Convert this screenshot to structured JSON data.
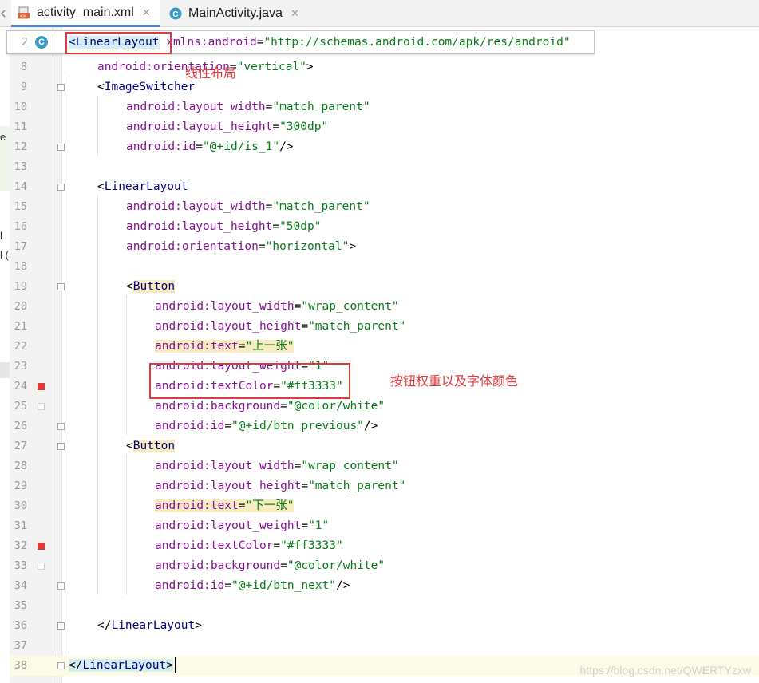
{
  "tabs": [
    {
      "label": "activity_main.xml",
      "icon": "xml-file-icon",
      "active": true
    },
    {
      "label": "MainActivity.java",
      "icon": "java-class-icon",
      "active": false
    }
  ],
  "sticky": {
    "line": "2",
    "badge": "C",
    "tag": "<LinearLayout",
    "rest_attr": " xmlns:android",
    "rest_eq": "=",
    "rest_str": "\"http://schemas.android.com/apk/res/android\""
  },
  "left_cut": {
    "e": "e",
    "l": "l",
    "paren": "l ("
  },
  "annotations": {
    "layout_note": "线性布局",
    "button_note": "按钮权重以及字体颜色"
  },
  "lines": [
    {
      "n": "8",
      "indent": "    ",
      "parts": [
        [
          "attr",
          "android:ori"
        ],
        [
          "attr",
          "entation"
        ],
        [
          "pun",
          "="
        ],
        [
          "str",
          "\"vertical\""
        ],
        [
          "pun",
          ">"
        ]
      ]
    },
    {
      "n": "9",
      "indent": "    ",
      "parts": [
        [
          "pun",
          "<"
        ],
        [
          "tag",
          "ImageSwitcher"
        ]
      ]
    },
    {
      "n": "10",
      "indent": "        ",
      "parts": [
        [
          "attr",
          "android:layout_width"
        ],
        [
          "pun",
          "="
        ],
        [
          "str",
          "\"match_parent\""
        ]
      ]
    },
    {
      "n": "11",
      "indent": "        ",
      "parts": [
        [
          "attr",
          "android:layout_height"
        ],
        [
          "pun",
          "="
        ],
        [
          "str",
          "\"300dp\""
        ]
      ]
    },
    {
      "n": "12",
      "indent": "        ",
      "parts": [
        [
          "attr",
          "android:id"
        ],
        [
          "pun",
          "="
        ],
        [
          "str",
          "\"@+id/is_1\""
        ],
        [
          "pun",
          "/>"
        ]
      ]
    },
    {
      "n": "13",
      "indent": "",
      "parts": []
    },
    {
      "n": "14",
      "indent": "    ",
      "parts": [
        [
          "pun",
          "<"
        ],
        [
          "tag",
          "LinearLayout"
        ]
      ]
    },
    {
      "n": "15",
      "indent": "        ",
      "parts": [
        [
          "attr",
          "android:layout_width"
        ],
        [
          "pun",
          "="
        ],
        [
          "str",
          "\"match_parent\""
        ]
      ]
    },
    {
      "n": "16",
      "indent": "        ",
      "parts": [
        [
          "attr",
          "android:layout_height"
        ],
        [
          "pun",
          "="
        ],
        [
          "str",
          "\"50dp\""
        ]
      ]
    },
    {
      "n": "17",
      "indent": "        ",
      "parts": [
        [
          "attr",
          "android:orientation"
        ],
        [
          "pun",
          "="
        ],
        [
          "str",
          "\"horizontal\""
        ],
        [
          "pun",
          ">"
        ]
      ]
    },
    {
      "n": "18",
      "indent": "",
      "parts": []
    },
    {
      "n": "19",
      "indent": "        ",
      "parts": [
        [
          "pun",
          "<"
        ],
        [
          "tag-hl",
          "Button"
        ]
      ]
    },
    {
      "n": "20",
      "indent": "            ",
      "parts": [
        [
          "attr",
          "android:layout_width"
        ],
        [
          "pun",
          "="
        ],
        [
          "str",
          "\"wrap_content\""
        ]
      ]
    },
    {
      "n": "21",
      "indent": "            ",
      "parts": [
        [
          "attr",
          "android:layout_height"
        ],
        [
          "pun",
          "="
        ],
        [
          "str",
          "\"match_parent\""
        ]
      ]
    },
    {
      "n": "22",
      "indent": "            ",
      "parts": [
        [
          "attr-hl",
          "android:text"
        ],
        [
          "pun-hl",
          "="
        ],
        [
          "str-hl",
          "\"上一张\""
        ]
      ]
    },
    {
      "n": "23",
      "indent": "            ",
      "parts": [
        [
          "attr",
          "android:layout_weight"
        ],
        [
          "pun",
          "="
        ],
        [
          "str",
          "\"1\""
        ]
      ]
    },
    {
      "n": "24",
      "indent": "            ",
      "parts": [
        [
          "attr",
          "android:textColor"
        ],
        [
          "pun",
          "="
        ],
        [
          "str",
          "\"#ff3333\""
        ]
      ]
    },
    {
      "n": "25",
      "indent": "            ",
      "parts": [
        [
          "attr",
          "android:background"
        ],
        [
          "pun",
          "="
        ],
        [
          "str",
          "\"@color/white\""
        ]
      ]
    },
    {
      "n": "26",
      "indent": "            ",
      "parts": [
        [
          "attr",
          "android:id"
        ],
        [
          "pun",
          "="
        ],
        [
          "str",
          "\"@+id/btn_previous\""
        ],
        [
          "pun",
          "/>"
        ]
      ]
    },
    {
      "n": "27",
      "indent": "        ",
      "parts": [
        [
          "pun",
          "<"
        ],
        [
          "tag-hl",
          "Button"
        ]
      ]
    },
    {
      "n": "28",
      "indent": "            ",
      "parts": [
        [
          "attr",
          "android:layout_width"
        ],
        [
          "pun",
          "="
        ],
        [
          "str",
          "\"wrap_content\""
        ]
      ]
    },
    {
      "n": "29",
      "indent": "            ",
      "parts": [
        [
          "attr",
          "android:layout_height"
        ],
        [
          "pun",
          "="
        ],
        [
          "str",
          "\"match_parent\""
        ]
      ]
    },
    {
      "n": "30",
      "indent": "            ",
      "parts": [
        [
          "attr-hl",
          "android:text"
        ],
        [
          "pun-hl",
          "="
        ],
        [
          "str-hl",
          "\"下一张\""
        ]
      ]
    },
    {
      "n": "31",
      "indent": "            ",
      "parts": [
        [
          "attr",
          "android:layout_weight"
        ],
        [
          "pun",
          "="
        ],
        [
          "str",
          "\"1\""
        ]
      ]
    },
    {
      "n": "32",
      "indent": "            ",
      "parts": [
        [
          "attr",
          "android:textColor"
        ],
        [
          "pun",
          "="
        ],
        [
          "str",
          "\"#ff3333\""
        ]
      ]
    },
    {
      "n": "33",
      "indent": "            ",
      "parts": [
        [
          "attr",
          "android:background"
        ],
        [
          "pun",
          "="
        ],
        [
          "str",
          "\"@color/white\""
        ]
      ]
    },
    {
      "n": "34",
      "indent": "            ",
      "parts": [
        [
          "attr",
          "android:id"
        ],
        [
          "pun",
          "="
        ],
        [
          "str",
          "\"@+id/btn_next\""
        ],
        [
          "pun",
          "/>"
        ]
      ]
    },
    {
      "n": "35",
      "indent": "",
      "parts": []
    },
    {
      "n": "36",
      "indent": "    ",
      "parts": [
        [
          "pun",
          "</"
        ],
        [
          "tag",
          "LinearLayout"
        ],
        [
          "pun",
          ">"
        ]
      ]
    },
    {
      "n": "37",
      "indent": "",
      "parts": []
    },
    {
      "n": "38",
      "indent": "",
      "parts": [
        [
          "pun-hl2",
          "</"
        ],
        [
          "tag-hl2",
          "LinearLayout"
        ],
        [
          "pun-hl2",
          ">"
        ]
      ]
    }
  ],
  "color_markers": {
    "24": "#e53935",
    "25": "#ffffff",
    "32": "#e53935",
    "33": "#ffffff"
  },
  "watermark": "https://blog.csdn.net/QWERTYzxw"
}
